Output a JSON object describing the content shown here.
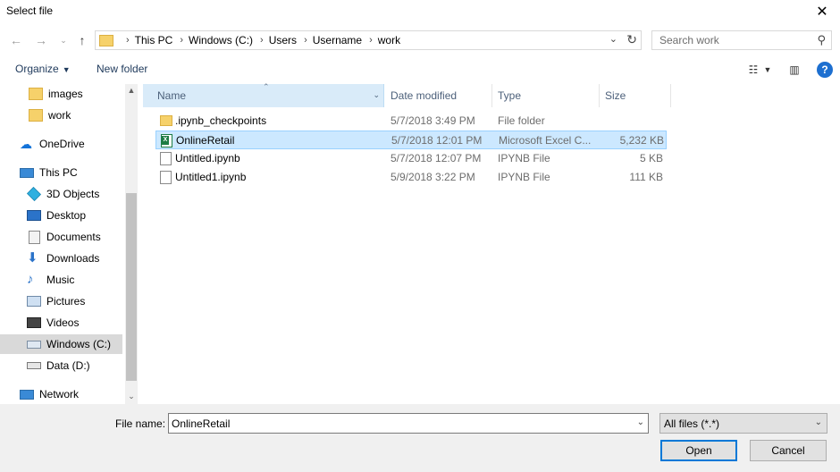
{
  "window": {
    "title": "Select file"
  },
  "nav": {
    "breadcrumbs": [
      "This PC",
      "Windows (C:)",
      "Users",
      "Username",
      "work"
    ],
    "search_placeholder": "Search work"
  },
  "toolbar": {
    "organize": "Organize",
    "new_folder": "New folder"
  },
  "sidebar": {
    "items": [
      {
        "label": "images",
        "icon": "folder-icon"
      },
      {
        "label": "work",
        "icon": "folder-icon"
      },
      {
        "label": "OneDrive",
        "icon": "cloud-icon"
      },
      {
        "label": "This PC",
        "icon": "computer-icon"
      },
      {
        "label": "3D Objects",
        "icon": "3d-objects-icon"
      },
      {
        "label": "Desktop",
        "icon": "desktop-icon"
      },
      {
        "label": "Documents",
        "icon": "documents-icon"
      },
      {
        "label": "Downloads",
        "icon": "downloads-icon"
      },
      {
        "label": "Music",
        "icon": "music-icon"
      },
      {
        "label": "Pictures",
        "icon": "pictures-icon"
      },
      {
        "label": "Videos",
        "icon": "videos-icon"
      },
      {
        "label": "Windows (C:)",
        "icon": "drive-icon",
        "selected": true
      },
      {
        "label": "Data (D:)",
        "icon": "drive-icon"
      },
      {
        "label": "Network",
        "icon": "network-icon"
      }
    ]
  },
  "columns": {
    "name": "Name",
    "date": "Date modified",
    "type": "Type",
    "size": "Size"
  },
  "files": [
    {
      "name": ".ipynb_checkpoints",
      "date": "5/7/2018 3:49 PM",
      "type": "File folder",
      "size": "",
      "icon": "folder-icon"
    },
    {
      "name": "OnlineRetail",
      "date": "5/7/2018 12:01 PM",
      "type": "Microsoft Excel C...",
      "size": "5,232 KB",
      "icon": "excel-icon",
      "selected": true
    },
    {
      "name": "Untitled.ipynb",
      "date": "5/7/2018 12:07 PM",
      "type": "IPYNB File",
      "size": "5 KB",
      "icon": "file-icon"
    },
    {
      "name": "Untitled1.ipynb",
      "date": "5/9/2018 3:22 PM",
      "type": "IPYNB File",
      "size": "111 KB",
      "icon": "file-icon"
    }
  ],
  "footer": {
    "file_name_label": "File name:",
    "file_name_value": "OnlineRetail",
    "file_type": "All files (*.*)",
    "open": "Open",
    "cancel": "Cancel"
  }
}
